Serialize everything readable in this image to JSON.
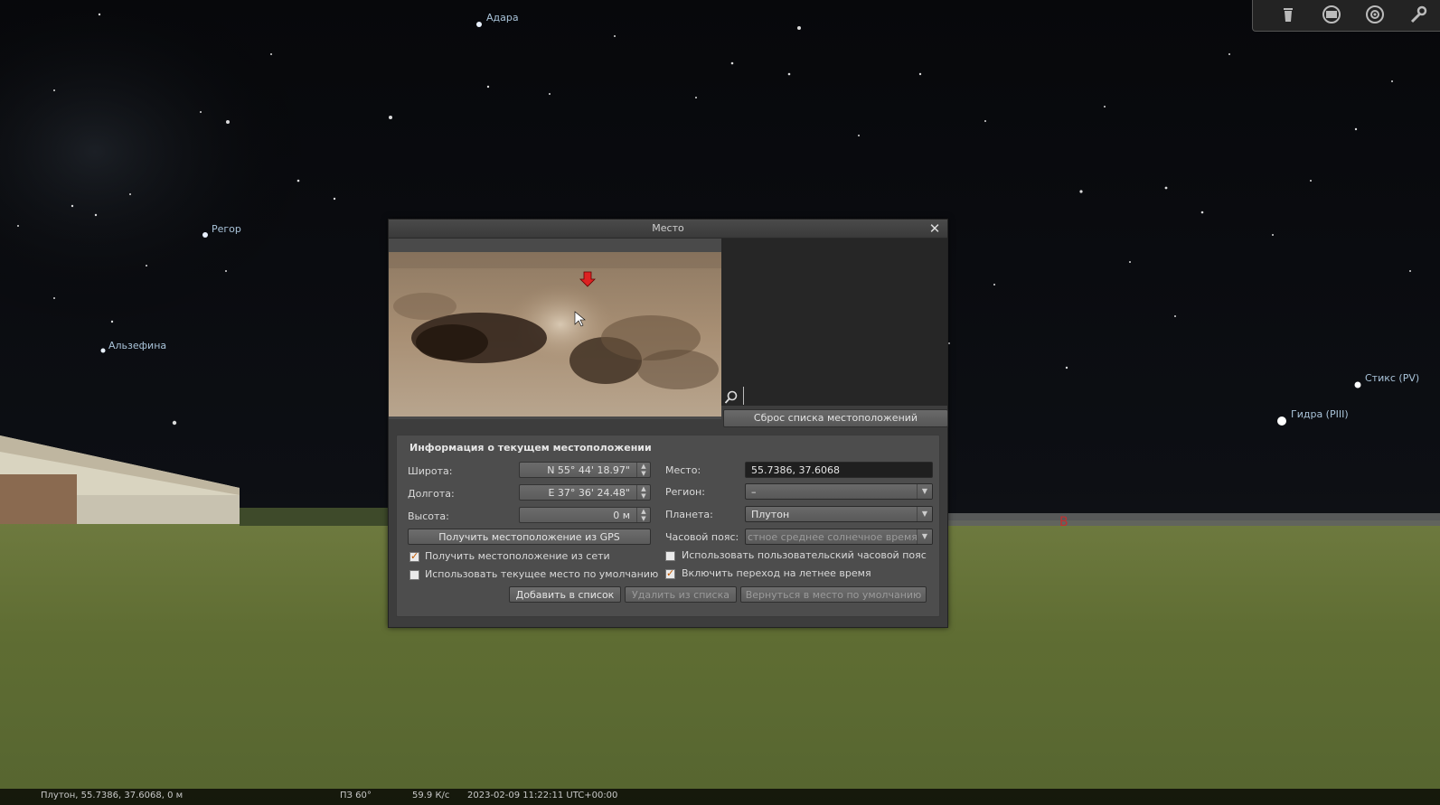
{
  "dialog": {
    "title": "Место",
    "reset_list_label": "Сброс списка местоположений",
    "search_placeholder": "",
    "info_title": "Информация о текущем местоположении",
    "latitude_label": "Широта:",
    "latitude_value": "N 55° 44' 18.97\"",
    "longitude_label": "Долгота:",
    "longitude_value": "E 37° 36' 24.48\"",
    "altitude_label": "Высота:",
    "altitude_value": "0 м",
    "gps_button": "Получить местоположение из GPS",
    "network_checkbox": "Получить местоположение из сети",
    "network_checked": true,
    "default_checkbox": "Использовать текущее место по умолчанию",
    "default_checked": false,
    "place_label": "Место:",
    "place_value": "55.7386, 37.6068",
    "region_label": "Регион:",
    "region_value": "–",
    "planet_label": "Планета:",
    "planet_value": "Плутон",
    "timezone_label": "Часовой пояс:",
    "timezone_value": "стное среднее солнечное время",
    "custom_tz_checkbox": "Использовать пользовательский часовой пояс",
    "custom_tz_checked": false,
    "dst_checkbox": "Включить переход на летнее время",
    "dst_checked": true,
    "add_button": "Добавить в список",
    "remove_button": "Удалить из списка",
    "return_button": "Вернуться в место по умолчанию"
  },
  "sky": {
    "labels": [
      "Адара",
      "Регор",
      "Альзефина",
      "Стикс (PV)",
      "Гидра (PIII)"
    ],
    "cardinal": "В"
  },
  "status": {
    "location": "Плутон, 55.7386, 37.6068, 0 м",
    "fov": "ПЗ 60°",
    "fps": "59.9 К/с",
    "datetime": "2023-02-09 11:22:11 UTC+00:00"
  },
  "toolbar": {
    "icons": [
      "trash-icon",
      "screen-icon",
      "target-icon",
      "wrench-icon"
    ]
  }
}
